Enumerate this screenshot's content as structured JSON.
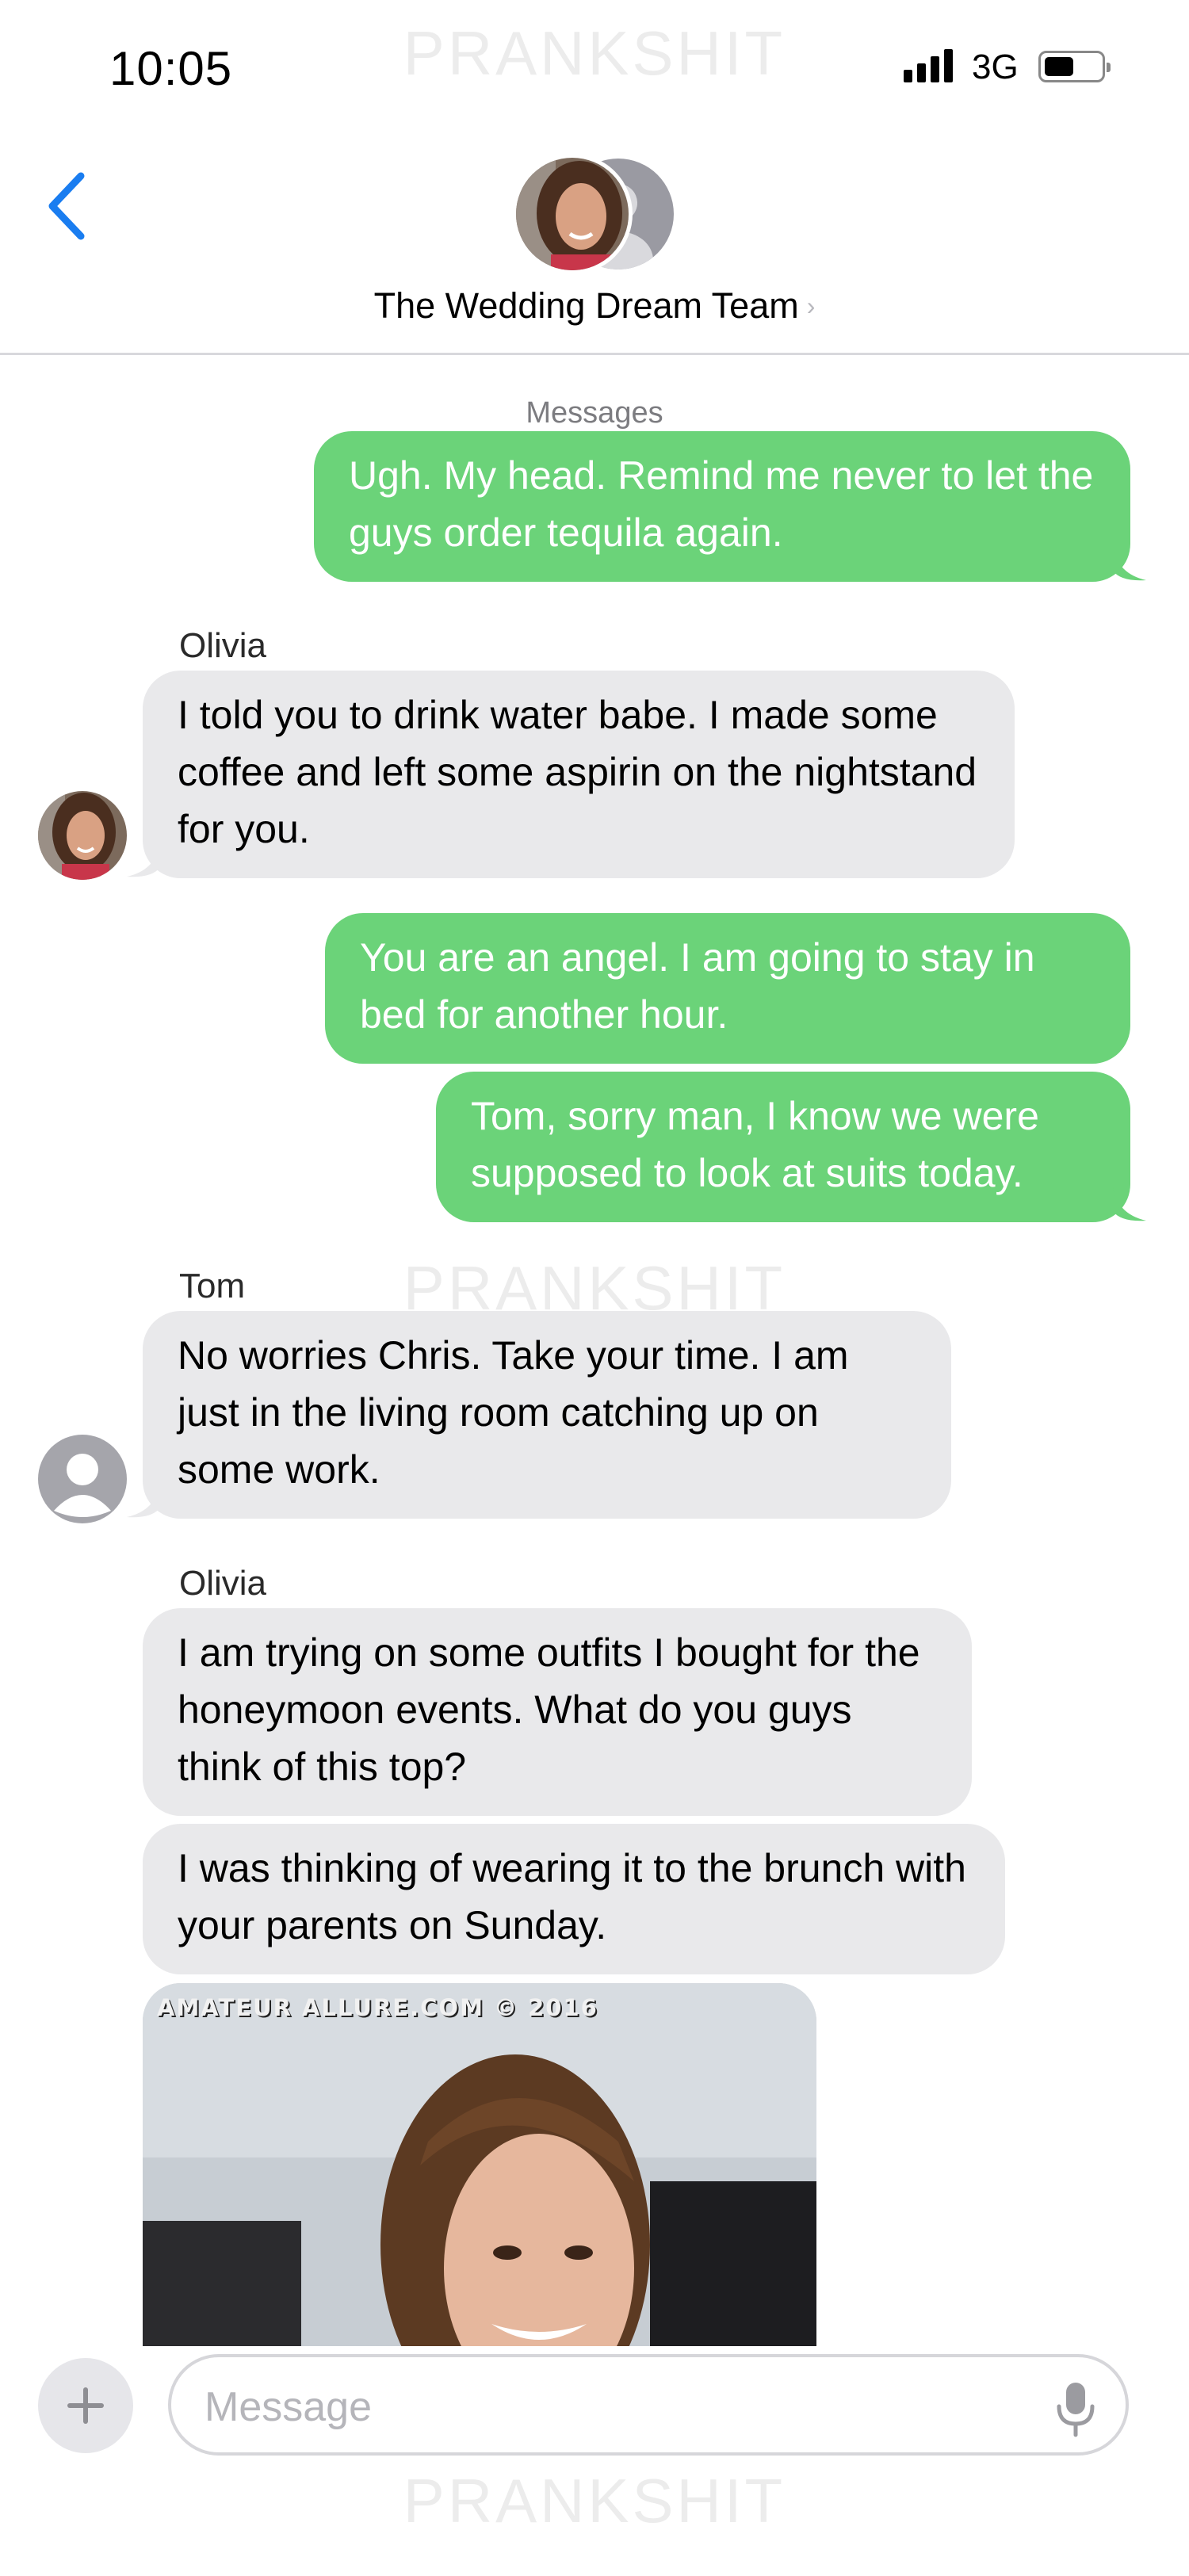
{
  "status_bar": {
    "time": "10:05",
    "network": "3G"
  },
  "watermark": {
    "text": "PRANKSHIT"
  },
  "header": {
    "back_icon": "chevron-left-icon",
    "title": "The Wedding Dream Team",
    "title_chevron": "›"
  },
  "thread": {
    "service_label": "Messages",
    "messages": [
      {
        "direction": "out",
        "text": "Ugh. My head. Remind me never to let the guys order tequila again."
      },
      {
        "direction": "in",
        "sender": "Olivia",
        "text": "I told you to drink water babe. I made some coffee and left some aspirin on the nightstand for you."
      },
      {
        "direction": "out",
        "text": "You are an angel. I am going to stay in bed for another hour."
      },
      {
        "direction": "out",
        "text": "Tom, sorry man, I know we were supposed to look at suits today."
      },
      {
        "direction": "in",
        "sender": "Tom",
        "text": "No worries Chris. Take your time. I am just in the living room catching up on some work."
      },
      {
        "direction": "in",
        "sender": "Olivia",
        "text": "I am trying on some outfits I bought for the honeymoon events. What do you guys think of this top?"
      },
      {
        "direction": "in",
        "text": "I was thinking of wearing it to the brunch with your parents on Sunday."
      }
    ],
    "photo_credit": "AMATEUR ALLURE.COM © 2016"
  },
  "compose": {
    "placeholder": "Message",
    "value": "",
    "add_icon": "plus-icon",
    "mic_icon": "microphone-icon"
  },
  "colors": {
    "outgoing_bubble": "#6bd379",
    "incoming_bubble": "#e9e9eb",
    "accent": "#1a7df0"
  }
}
